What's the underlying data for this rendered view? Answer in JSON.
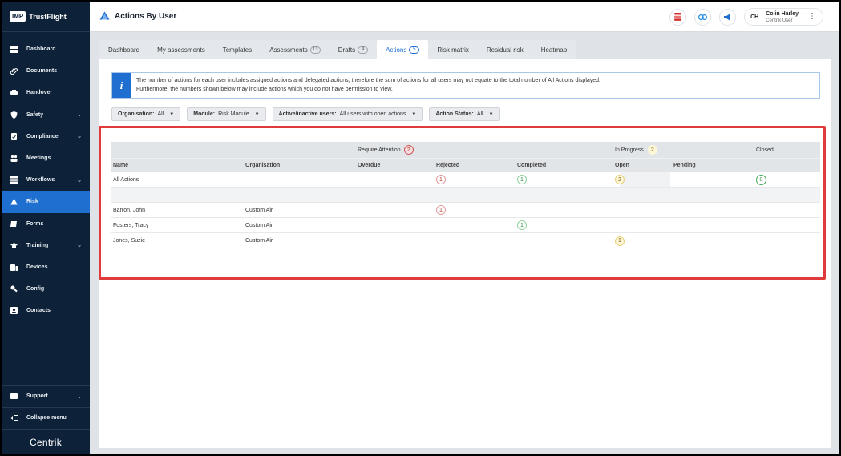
{
  "brand": {
    "logo": "IMP",
    "name": "TrustFlight",
    "footer_logo": "Centrik"
  },
  "sidebar": {
    "items": [
      {
        "label": "Dashboard",
        "icon": "dashboard-icon"
      },
      {
        "label": "Documents",
        "icon": "paperclip-icon"
      },
      {
        "label": "Handover",
        "icon": "handover-icon"
      },
      {
        "label": "Safety",
        "icon": "shield-icon",
        "expandable": true
      },
      {
        "label": "Compliance",
        "icon": "compliance-icon",
        "expandable": true
      },
      {
        "label": "Meetings",
        "icon": "meetings-icon"
      },
      {
        "label": "Workflows",
        "icon": "workflows-icon",
        "expandable": true
      },
      {
        "label": "Risk",
        "icon": "risk-icon",
        "active": true
      },
      {
        "label": "Forms",
        "icon": "forms-icon"
      },
      {
        "label": "Training",
        "icon": "graduation-cap-icon",
        "expandable": true
      },
      {
        "label": "Devices",
        "icon": "devices-icon"
      },
      {
        "label": "Config",
        "icon": "config-icon"
      },
      {
        "label": "Contacts",
        "icon": "contacts-icon"
      }
    ],
    "support": "Support",
    "collapse": "Collapse menu"
  },
  "header": {
    "title": "Actions By User",
    "user": {
      "initials": "CH",
      "name": "Colin Harley",
      "role": "Centrik User"
    }
  },
  "tabs": [
    {
      "label": "Dashboard"
    },
    {
      "label": "My assessments"
    },
    {
      "label": "Templates"
    },
    {
      "label": "Assessments",
      "count": "13"
    },
    {
      "label": "Drafts",
      "count": "4"
    },
    {
      "label": "Actions",
      "count": "5",
      "active": true
    },
    {
      "label": "Risk matrix"
    },
    {
      "label": "Residual risk"
    },
    {
      "label": "Heatmap"
    }
  ],
  "info": {
    "icon": "i",
    "line1": "The number of actions for each user includes assigned actions and delegated actions, therefore the sum of actions for all users may not equate to the total number of All Actions displayed.",
    "line2": "Furthermore, the numbers shown below may include actions which you do not have permission to view."
  },
  "filters": [
    {
      "label": "Organisation:",
      "value": "All"
    },
    {
      "label": "Module:",
      "value": "Risk Module"
    },
    {
      "label": "Active/inactive users:",
      "value": "All users with open actions"
    },
    {
      "label": "Action Status:",
      "value": "All"
    }
  ],
  "table": {
    "groups": {
      "require_attention": {
        "label": "Require Attention",
        "count": "2"
      },
      "in_progress": {
        "label": "In Progress",
        "count": "2"
      },
      "closed": {
        "label": "Closed"
      }
    },
    "columns": {
      "name": "Name",
      "organisation": "Organisation",
      "overdue": "Overdue",
      "rejected": "Rejected",
      "completed": "Completed",
      "open": "Open",
      "pending": "Pending"
    },
    "summary": {
      "name": "All Actions",
      "rejected": "1",
      "completed": "1",
      "open": "2",
      "closed": "0"
    },
    "rows": [
      {
        "name": "Barron, John",
        "organisation": "Custom Air",
        "rejected": "1",
        "completed": "",
        "open": ""
      },
      {
        "name": "Fosters, Tracy",
        "organisation": "Custom Air",
        "rejected": "",
        "completed": "1",
        "open": ""
      },
      {
        "name": "Jones, Suzie",
        "organisation": "Custom Air",
        "rejected": "",
        "completed": "",
        "open": "1"
      }
    ]
  },
  "colors": {
    "sidebar": "#0d2238",
    "accent": "#1e6fd0",
    "highlight": "#e03b3b"
  }
}
